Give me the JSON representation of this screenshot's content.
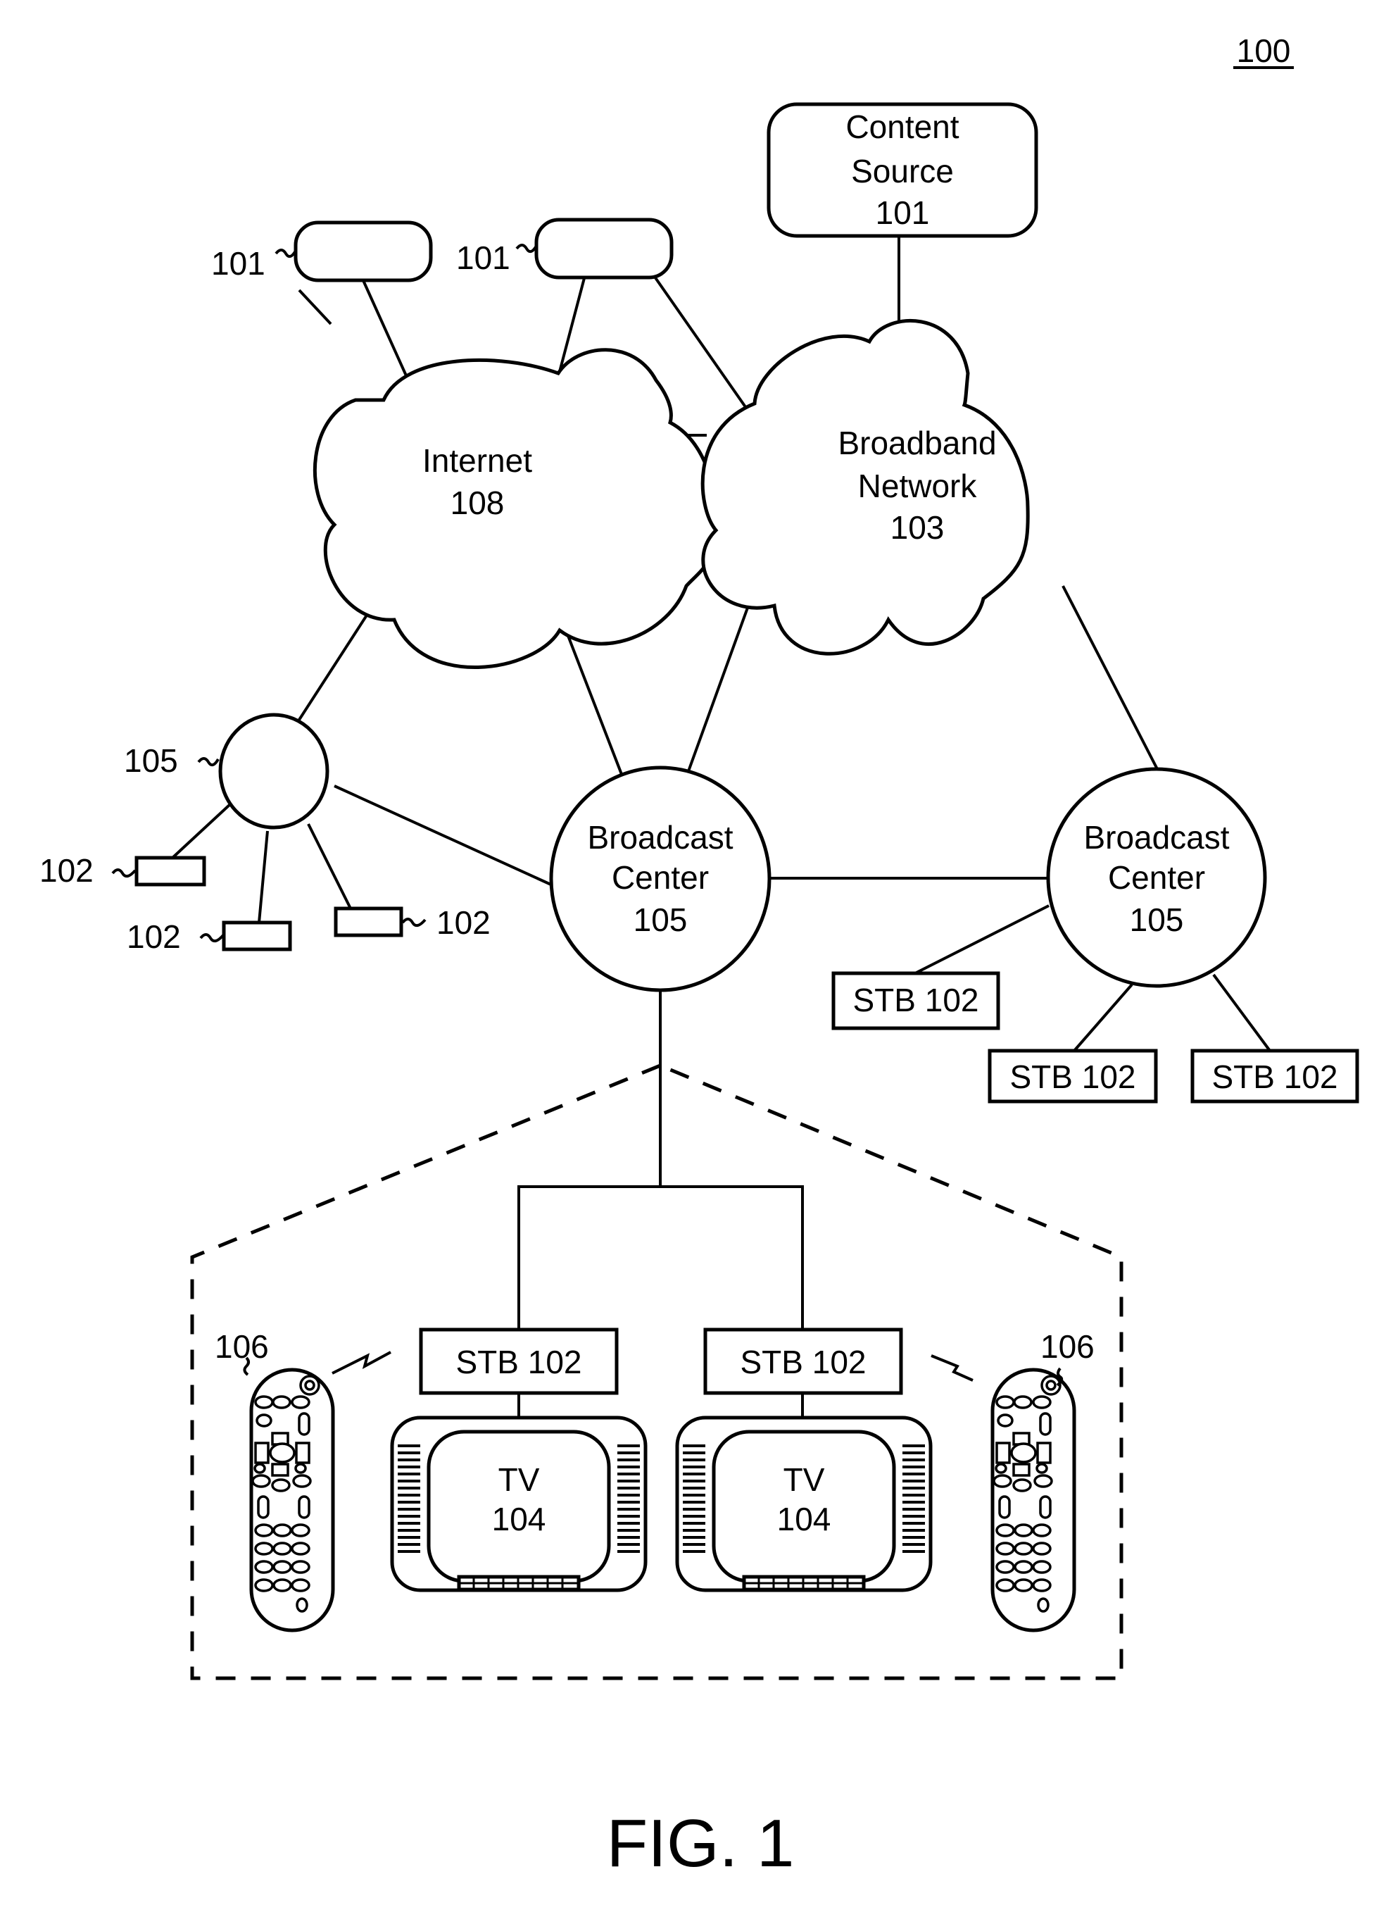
{
  "figure": {
    "reference_number": "100",
    "caption": "FIG. 1"
  },
  "nodes": {
    "content_source": {
      "lines": [
        "Content",
        "Source",
        "101"
      ]
    },
    "source_left": {
      "ref": "101"
    },
    "source_right": {
      "ref": "101"
    },
    "internet": {
      "lines": [
        "Internet",
        "108"
      ]
    },
    "broadband": {
      "lines": [
        "Broadband",
        "Network",
        "103"
      ]
    },
    "small_center": {
      "ref": "105"
    },
    "small_stbs": [
      {
        "ref": "102"
      },
      {
        "ref": "102"
      },
      {
        "ref": "102"
      }
    ],
    "broadcast_mid": {
      "lines": [
        "Broadcast",
        "Center",
        "105"
      ]
    },
    "broadcast_right": {
      "lines": [
        "Broadcast",
        "Center",
        "105"
      ]
    },
    "right_stbs": [
      {
        "label": "STB 102"
      },
      {
        "label": "STB 102"
      },
      {
        "label": "STB 102"
      }
    ],
    "home": {
      "stbs": [
        {
          "label": "STB 102"
        },
        {
          "label": "STB 102"
        }
      ],
      "tvs": [
        {
          "lines": [
            "TV",
            "104"
          ]
        },
        {
          "lines": [
            "TV",
            "104"
          ]
        }
      ],
      "remotes": [
        {
          "ref": "106"
        },
        {
          "ref": "106"
        }
      ]
    }
  }
}
